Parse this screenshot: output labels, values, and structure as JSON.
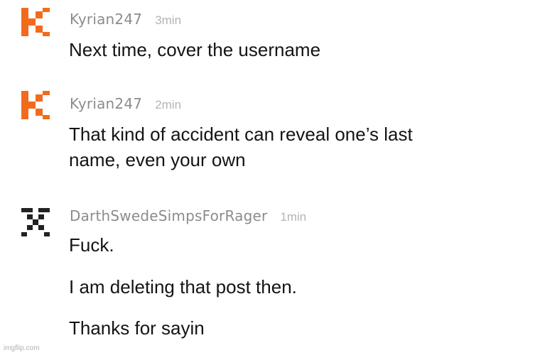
{
  "comments": [
    {
      "username": "Kyrian247",
      "time": "3min",
      "avatar_icon": "orange-k-pixel-icon",
      "avatar_color": "#f26b1d",
      "lines": [
        "Next time, cover the username"
      ]
    },
    {
      "username": "Kyrian247",
      "time": "2min",
      "avatar_icon": "orange-k-pixel-icon",
      "avatar_color": "#f26b1d",
      "lines": [
        "That kind of accident can reveal one’s last",
        "name, even your own"
      ]
    },
    {
      "username": "DarthSwedeSimpsForRager",
      "time": "1min",
      "avatar_icon": "checker-pixel-icon",
      "avatar_color": "#222222",
      "lines": [
        "Fuck.",
        "I am deleting that post then.",
        "Thanks for sayin"
      ]
    }
  ],
  "watermark": "imgflip.com"
}
